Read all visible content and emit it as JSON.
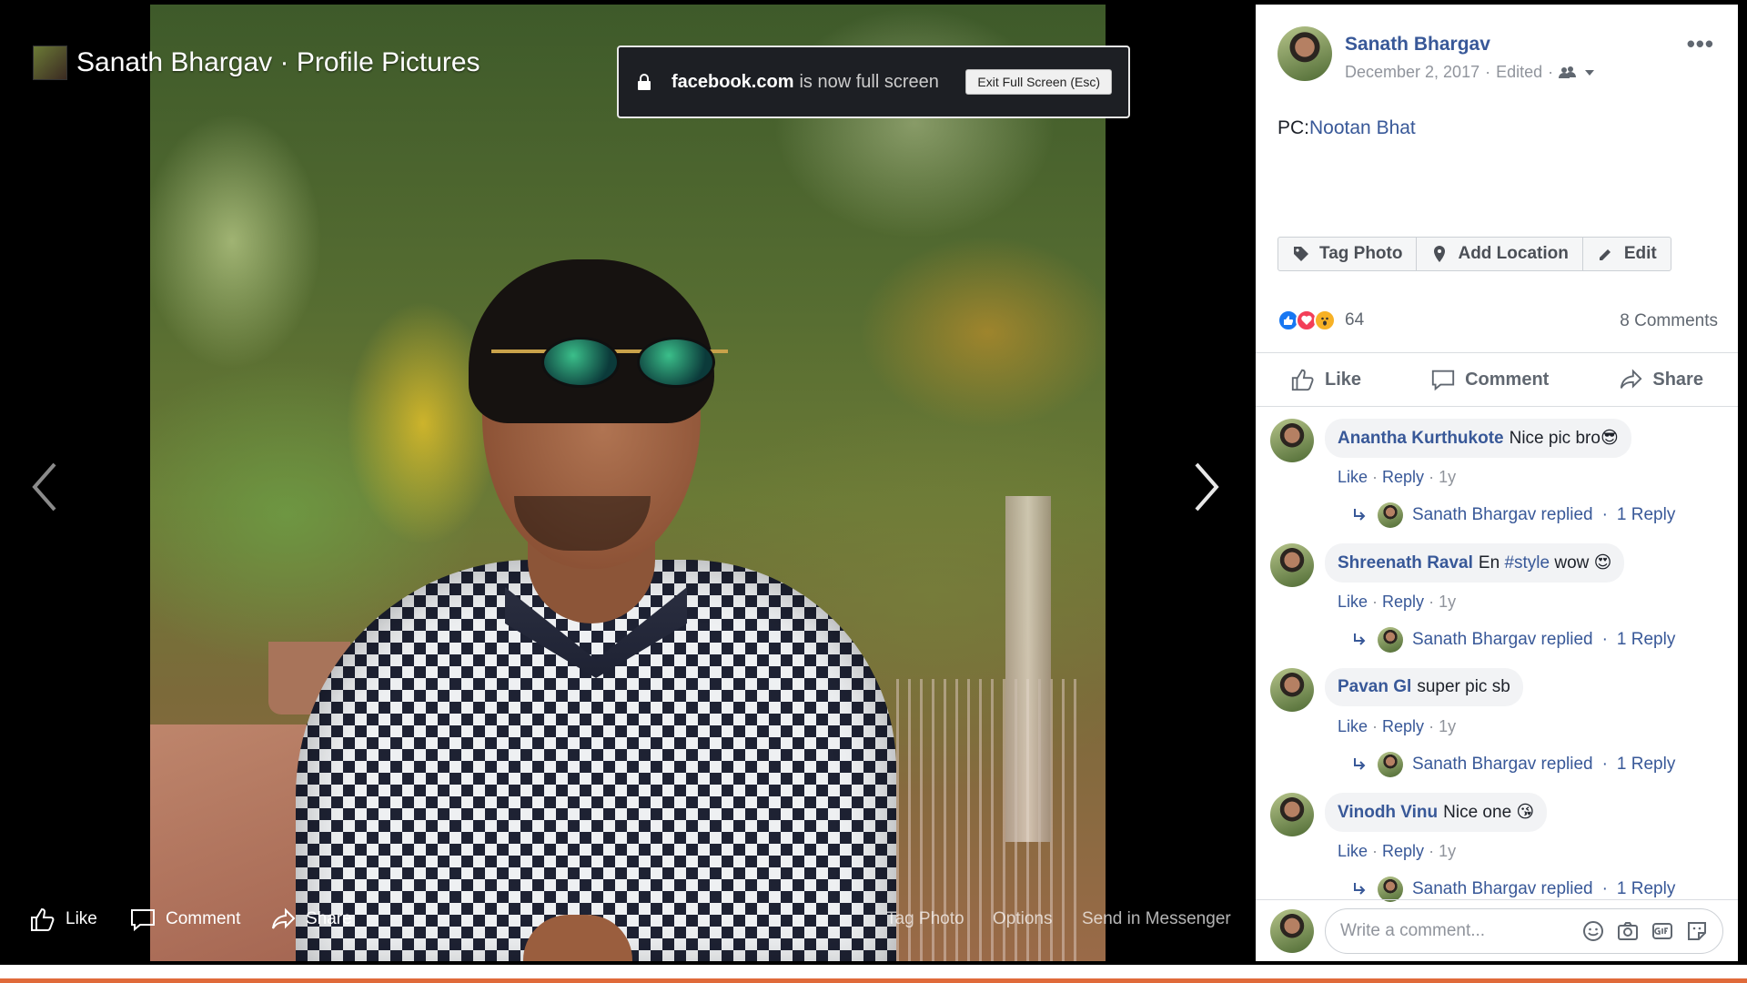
{
  "viewer": {
    "title": "Sanath Bhargav · Profile Pictures",
    "bottom_actions": {
      "like": "Like",
      "comment": "Comment",
      "share": "Share"
    },
    "right_actions": {
      "tag_photo": "Tag Photo",
      "options": "Options",
      "send_messenger": "Send in Messenger"
    }
  },
  "fullscreen_notice": {
    "domain": "facebook.com",
    "message": "is now full screen",
    "exit_label": "Exit Full Screen (Esc)"
  },
  "post": {
    "author": "Sanath Bhargav",
    "date": "December 2, 2017",
    "edited": "Edited",
    "caption_prefix": "PC:",
    "caption_link": "Nootan Bhat",
    "photo_actions": {
      "tag": "Tag Photo",
      "location": "Add Location",
      "edit": "Edit"
    },
    "reaction_count": "64",
    "comment_count": "8 Comments",
    "actions": {
      "like": "Like",
      "comment": "Comment",
      "share": "Share"
    }
  },
  "comments": [
    {
      "author": "Anantha Kurthukote",
      "text": "Nice pic bro",
      "emoji": "😎",
      "like": "Like",
      "reply": "Reply",
      "time": "1y",
      "reply_author": "Sanath Bhargav replied",
      "reply_count": "1 Reply"
    },
    {
      "author": "Shreenath Raval",
      "text": "En",
      "hashtag": "#style",
      "text_after": "wow",
      "emoji": "😍",
      "like": "Like",
      "reply": "Reply",
      "time": "1y",
      "reply_author": "Sanath Bhargav replied",
      "reply_count": "1 Reply"
    },
    {
      "author": "Pavan Gl",
      "text": "super pic sb",
      "emoji": "",
      "like": "Like",
      "reply": "Reply",
      "time": "1y",
      "reply_author": "Sanath Bhargav replied",
      "reply_count": "1 Reply"
    },
    {
      "author": "Vinodh Vinu",
      "text": "Nice one",
      "emoji": "😘",
      "like": "Like",
      "reply": "Reply",
      "time": "1y",
      "reply_author": "Sanath Bhargav replied",
      "reply_count": "1 Reply"
    }
  ],
  "composer": {
    "placeholder": "Write a comment..."
  },
  "colors": {
    "link": "#385898",
    "accent_bar": "#e06a3a",
    "like_blue": "#1877f2",
    "love_red": "#f33e58"
  }
}
